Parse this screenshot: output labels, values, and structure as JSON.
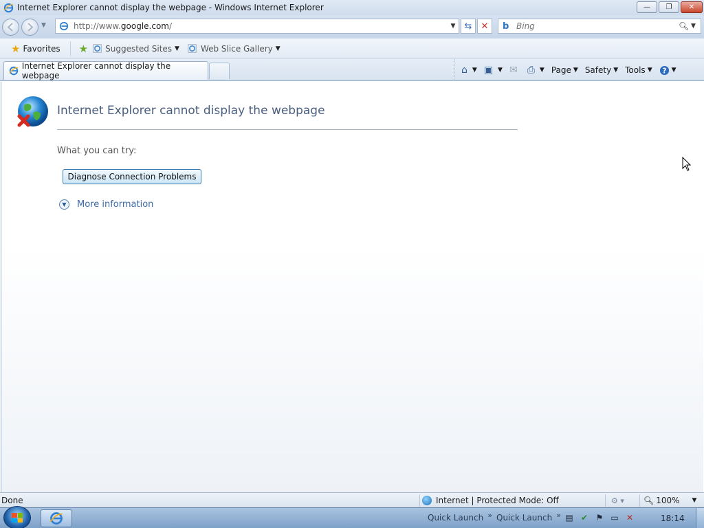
{
  "window": {
    "title": "Internet Explorer cannot display the webpage - Windows Internet Explorer",
    "buttons": {
      "minimize": "—",
      "maximize": "❐",
      "close": "✕"
    }
  },
  "address_bar": {
    "url_prefix": "http://www.",
    "url_domain": "google.com",
    "url_suffix": "/"
  },
  "search": {
    "placeholder": "Bing"
  },
  "favorites_bar": {
    "favorites_label": "Favorites",
    "links": [
      {
        "label": "Suggested Sites"
      },
      {
        "label": "Web Slice Gallery"
      }
    ]
  },
  "tabs": [
    {
      "label": "Internet Explorer cannot display the webpage"
    }
  ],
  "command_bar": {
    "page_label": "Page",
    "safety_label": "Safety",
    "tools_label": "Tools"
  },
  "content": {
    "heading": "Internet Explorer cannot display the webpage",
    "try_label": "What you can try:",
    "diagnose_button": "Diagnose Connection Problems",
    "more_info": "More information"
  },
  "status_bar": {
    "status_text": "Done",
    "zone_text": "Internet | Protected Mode: Off",
    "zoom": "100%"
  },
  "taskbar": {
    "quick_launch_1": "Quick Launch",
    "quick_launch_2": "Quick Launch",
    "clock": "18:14"
  },
  "colors": {
    "heading": "#4a5f80",
    "link": "#3a6aa8",
    "taskbar": "#7ea1c8"
  },
  "icons": [
    "ie-icon",
    "back-icon",
    "forward-icon",
    "refresh-icon",
    "stop-icon",
    "bing-icon",
    "search-icon",
    "star-icon",
    "add-favorite-icon",
    "home-icon",
    "feeds-icon",
    "mail-icon",
    "print-icon",
    "help-icon",
    "globe-error-icon",
    "expand-icon",
    "cursor-icon",
    "start-orb-icon"
  ]
}
